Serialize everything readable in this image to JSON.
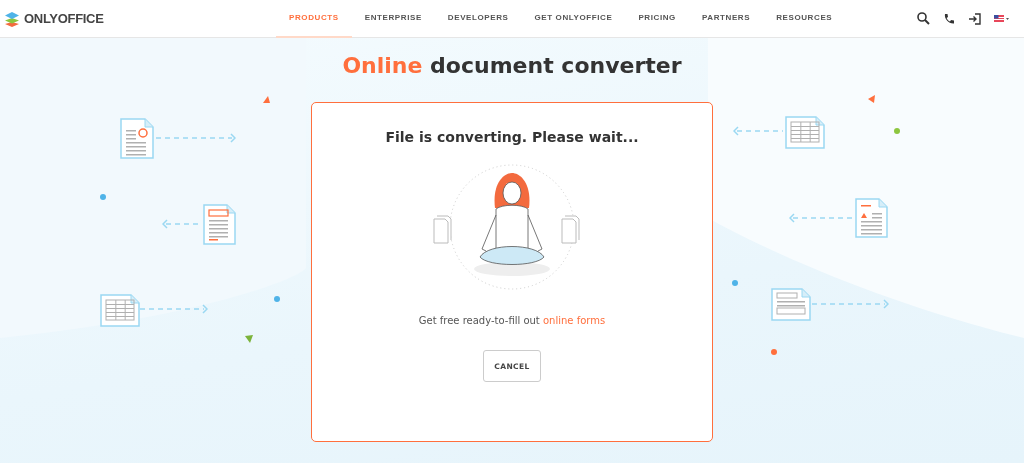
{
  "header": {
    "logo": "ONLYOFFICE",
    "nav": [
      {
        "label": "PRODUCTS",
        "selected": true
      },
      {
        "label": "ENTERPRISE",
        "selected": false
      },
      {
        "label": "DEVELOPERS",
        "selected": false
      },
      {
        "label": "GET ONLYOFFICE",
        "selected": false
      },
      {
        "label": "PRICING",
        "selected": false
      },
      {
        "label": "PARTNERS",
        "selected": false
      },
      {
        "label": "RESOURCES",
        "selected": false
      }
    ]
  },
  "title": {
    "accent": "Online",
    "rest": "document converter"
  },
  "dialog": {
    "heading": "File is converting. Please wait...",
    "promo": {
      "text": "Get free ready-to-fill out",
      "link": "online forms"
    },
    "button": "CANCEL"
  }
}
